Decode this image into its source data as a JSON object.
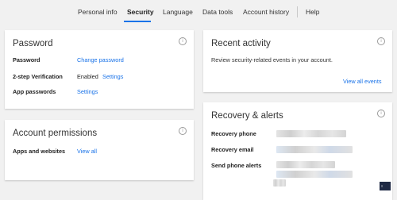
{
  "nav": {
    "tabs": [
      {
        "label": "Personal info"
      },
      {
        "label": "Security"
      },
      {
        "label": "Language"
      },
      {
        "label": "Data tools"
      },
      {
        "label": "Account history"
      },
      {
        "label": "Help"
      }
    ],
    "active_tab": "Security"
  },
  "password_card": {
    "title": "Password",
    "rows": [
      {
        "label": "Password",
        "link": "Change password"
      },
      {
        "label": "2-step Verification",
        "value": "Enabled",
        "link": "Settings"
      },
      {
        "label": "App passwords",
        "link": "Settings"
      }
    ]
  },
  "recent_activity_card": {
    "title": "Recent activity",
    "description": "Review security-related events in your account.",
    "link": "View all events"
  },
  "account_permissions_card": {
    "title": "Account permissions",
    "rows": [
      {
        "label": "Apps and websites",
        "link": "View all"
      }
    ]
  },
  "recovery_card": {
    "title": "Recovery & alerts",
    "rows": [
      {
        "label": "Recovery phone"
      },
      {
        "label": "Recovery email"
      },
      {
        "label": "Send phone alerts"
      }
    ]
  },
  "colors": {
    "accent": "#1a73e8",
    "background": "#f1f1f1",
    "card": "#ffffff"
  }
}
